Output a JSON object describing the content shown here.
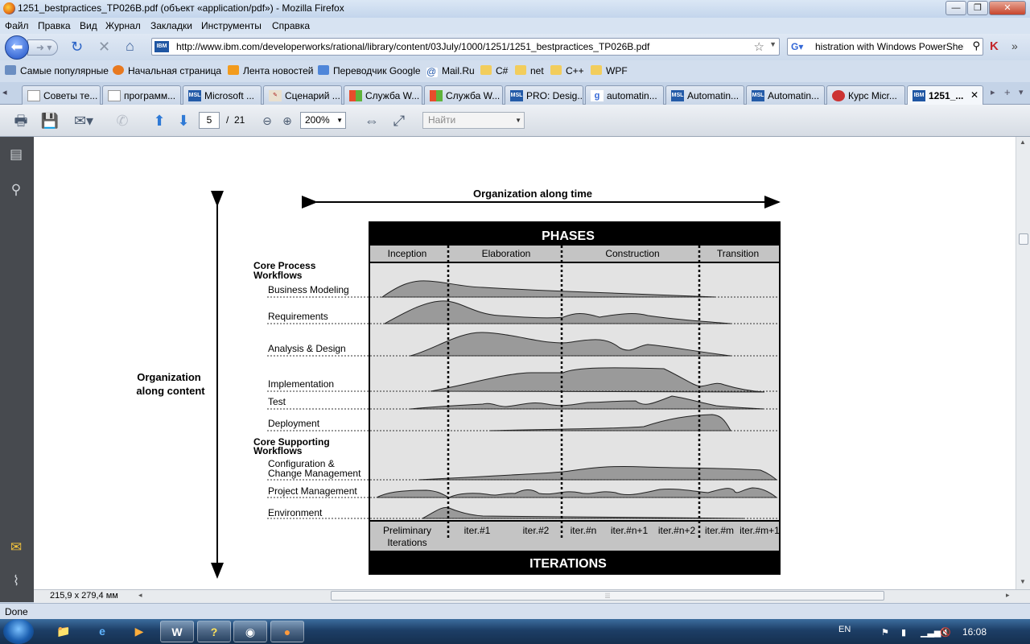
{
  "window": {
    "title": "1251_bestpractices_TP026B.pdf (объект «application/pdf») - Mozilla Firefox",
    "minimize": "—",
    "restore": "❐",
    "close": "✕"
  },
  "menu": [
    "Файл",
    "Правка",
    "Вид",
    "Журнал",
    "Закладки",
    "Инструменты",
    "Справка"
  ],
  "nav": {
    "url": "http://www.ibm.com/developerworks/rational/library/content/03July/1000/1251/1251_bestpractices_TP026B.pdf",
    "site_badge": "IBM",
    "search_text": "histration with Windows PowerShell"
  },
  "bookmarks": [
    "Самые популярные",
    "Начальная страница",
    "Лента новостей",
    "Переводчик Google",
    "Mail.Ru",
    "C#",
    "net",
    "C++",
    "WPF"
  ],
  "tabs": [
    {
      "label": "Советы те...",
      "icon": "page-icon"
    },
    {
      "label": "программ...",
      "icon": "page-icon"
    },
    {
      "label": "Microsoft ...",
      "icon": "msl-icon"
    },
    {
      "label": "Сценарий ...",
      "icon": "script-icon"
    },
    {
      "label": "Служба W...",
      "icon": "windows-icon"
    },
    {
      "label": "Служба W...",
      "icon": "windows-icon"
    },
    {
      "label": "PRO: Desig...",
      "icon": "msl-icon"
    },
    {
      "label": "automatin...",
      "icon": "google-icon"
    },
    {
      "label": "Automatin...",
      "icon": "msl-icon"
    },
    {
      "label": "Automatin...",
      "icon": "msl-icon"
    },
    {
      "label": "Курс Micr...",
      "icon": "globe-icon"
    },
    {
      "label": "1251_...",
      "icon": "ibm-icon",
      "active": true
    }
  ],
  "pdf_toolbar": {
    "page_current": "5",
    "page_separator": "/",
    "page_total": "21",
    "zoom": "200%",
    "find_placeholder": "Найти"
  },
  "page_size": "215,9 x 279,4 мм",
  "status": "Done",
  "taskbar": {
    "lang": "EN",
    "clock": "16:08"
  },
  "diagram": {
    "top_label": "Organization along time",
    "side_label_1": "Organization",
    "side_label_2": "along content",
    "header": "PHASES",
    "footer": "ITERATIONS",
    "phases": [
      "Inception",
      "Elaboration",
      "Construction",
      "Transition"
    ],
    "core_process_title_1": "Core Process",
    "core_process_title_2": "Workflows",
    "core_process": [
      "Business Modeling",
      "Requirements",
      "Analysis  &  Design",
      "Implementation",
      "Test",
      "Deployment"
    ],
    "core_supporting_title_1": "Core Supporting",
    "core_supporting_title_2": "Workflows",
    "config_label_1": "Configuration  &",
    "config_label_2": "Change  Management",
    "core_supporting": [
      "Project  Management",
      "Environment"
    ],
    "iterations": [
      "Preliminary",
      "Iterations",
      "iter.#1",
      "iter.#2",
      "iter.#n",
      "iter.#n+1",
      "iter.#n+2",
      "iter.#m",
      "iter.#m+1"
    ]
  }
}
